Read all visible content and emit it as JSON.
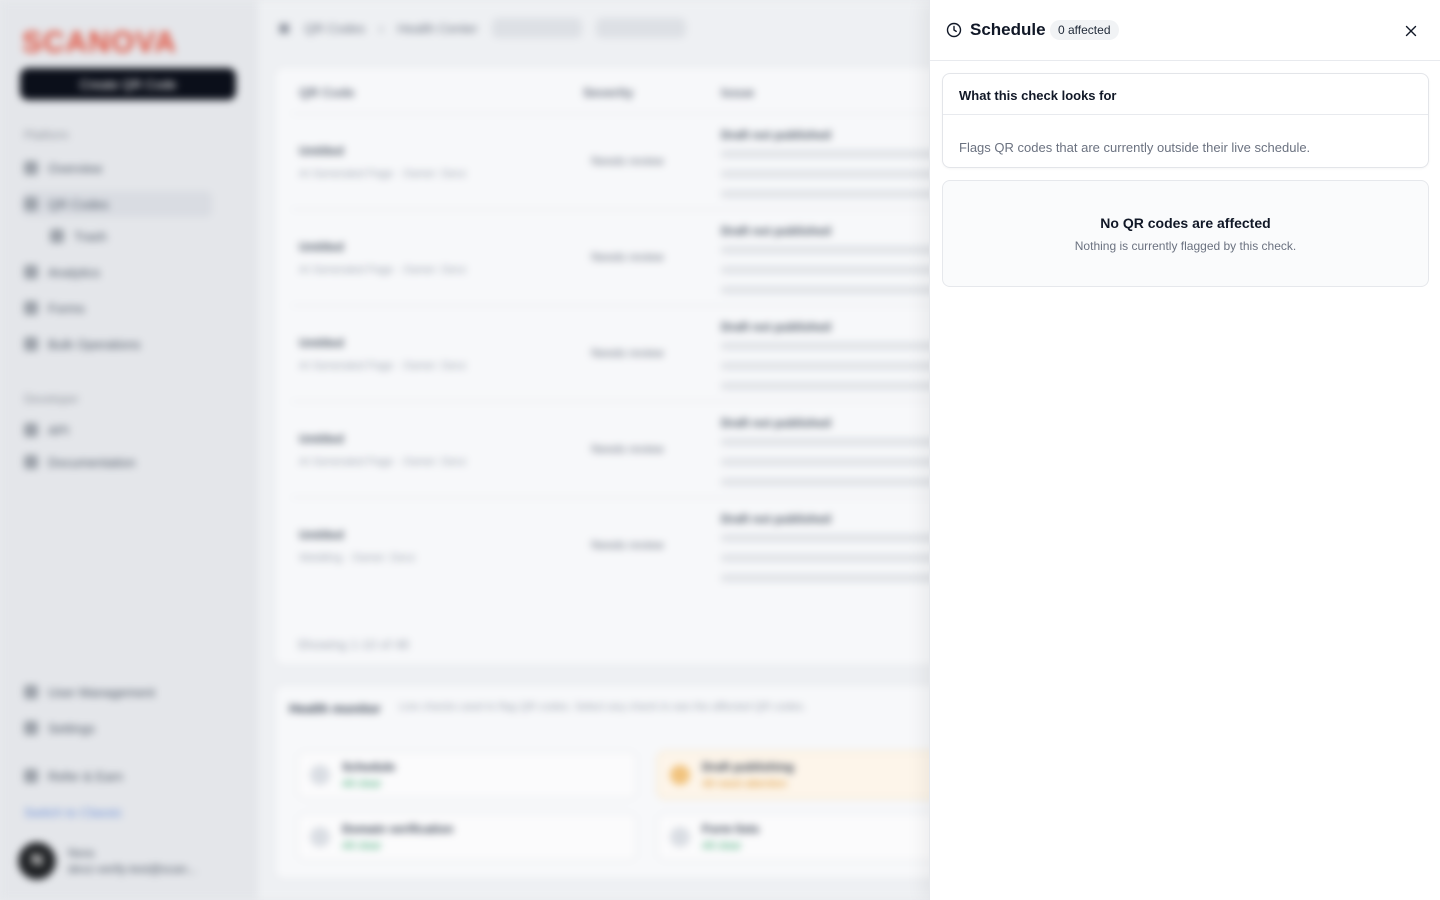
{
  "background": {
    "logo": "SCANOVA",
    "create_button": "Create QR Code",
    "sections": {
      "platform": "Platform",
      "developer": "Developer"
    },
    "nav": [
      {
        "label": "Overview"
      },
      {
        "label": "QR Codes"
      },
      {
        "label": "Trash"
      },
      {
        "label": "Analytics"
      },
      {
        "label": "Forms"
      },
      {
        "label": "Bulk Operations"
      },
      {
        "label": "API"
      },
      {
        "label": "Documentation"
      },
      {
        "label": "User Management"
      },
      {
        "label": "Settings"
      },
      {
        "label": "Refer & Earn"
      },
      {
        "label": "Switch to Classic"
      }
    ],
    "user": {
      "initial": "N",
      "name": "Nora",
      "email": "devz-verify-test@scan..."
    },
    "breadcrumb": {
      "root": "QR Codes",
      "current": "Health Center"
    },
    "table": {
      "headers": [
        "QR Code",
        "Severity",
        "Issue"
      ],
      "rows": [
        {
          "name": "Untitled",
          "sub": "AI Generated Page · Owner: Devz",
          "severity": "Needs review",
          "issue": "Draft not published"
        },
        {
          "name": "Untitled",
          "sub": "AI Generated Page · Owner: Devz",
          "severity": "Needs review",
          "issue": "Draft not published"
        },
        {
          "name": "Untitled",
          "sub": "AI Generated Page · Owner: Devz",
          "severity": "Needs review",
          "issue": "Draft not published"
        },
        {
          "name": "Untitled",
          "sub": "AI Generated Page · Owner: Devz",
          "severity": "Needs review",
          "issue": "Draft not published"
        },
        {
          "name": "Untitled",
          "sub": "Wedding · Owner: Devz",
          "severity": "Needs review",
          "issue": "Draft not published"
        }
      ],
      "showing": "Showing 1-10 of 48"
    },
    "health": {
      "title": "Health monitor",
      "desc": "Live checks used to flag QR codes. Select any check to see the affected QR codes.",
      "checks": [
        {
          "name": "Schedule",
          "status": "All clear"
        },
        {
          "name": "Draft publishing",
          "status": "48 need attention"
        },
        {
          "name": "Domain verification",
          "status": "All clear"
        },
        {
          "name": "Form lists",
          "status": "All clear"
        }
      ]
    }
  },
  "drawer": {
    "title": "Schedule",
    "badge": "0 affected",
    "info": {
      "heading": "What this check looks for",
      "body": "Flags QR codes that are currently outside their live schedule."
    },
    "empty": {
      "title": "No QR codes are affected",
      "subtitle": "Nothing is currently flagged by this check."
    }
  }
}
